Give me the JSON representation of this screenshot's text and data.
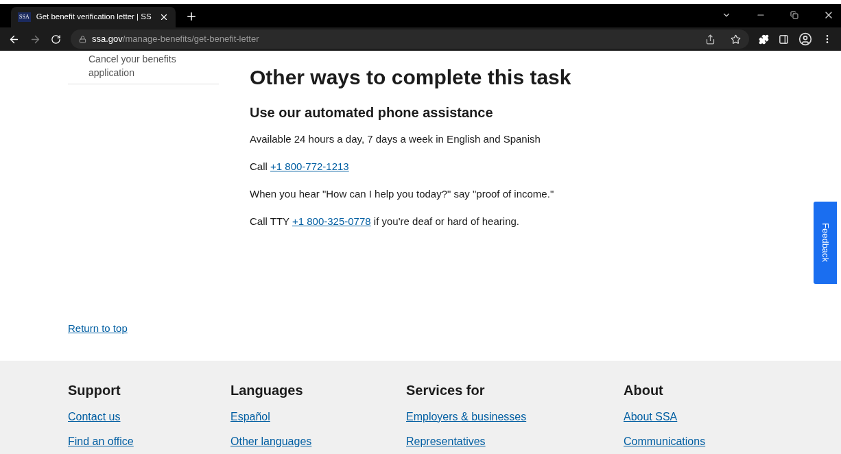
{
  "browser": {
    "tab": {
      "favicon": "SSA",
      "title": "Get benefit verification letter | SS",
      "selected": true
    },
    "url_domain": "ssa.gov",
    "url_path": "/manage-benefits/get-benefit-letter"
  },
  "sidebar": {
    "items": [
      "Cancel your benefits application"
    ]
  },
  "main": {
    "heading": "Other ways to complete this task",
    "subheading": "Use our automated phone assistance",
    "paragraphs": [
      {
        "before": "Available 24 hours a day, 7 days a week in English and Spanish"
      },
      {
        "before": "Call ",
        "link": "+1 800-772-1213"
      },
      {
        "before": "When you hear \"How can I help you today?\" say \"proof of income.\""
      },
      {
        "before": "Call TTY ",
        "link": "+1 800-325-0778",
        "after": " if you're deaf or hard of hearing."
      }
    ]
  },
  "feedback": "Feedback",
  "return_to_top": "Return to top",
  "footer": [
    {
      "title": "Support",
      "links": [
        "Contact us",
        "Find an office"
      ]
    },
    {
      "title": "Languages",
      "links": [
        "Español",
        "Other languages"
      ]
    },
    {
      "title": "Services for",
      "links": [
        "Employers & businesses",
        "Representatives"
      ]
    },
    {
      "title": "About",
      "links": [
        "About SSA",
        "Communications"
      ]
    }
  ]
}
